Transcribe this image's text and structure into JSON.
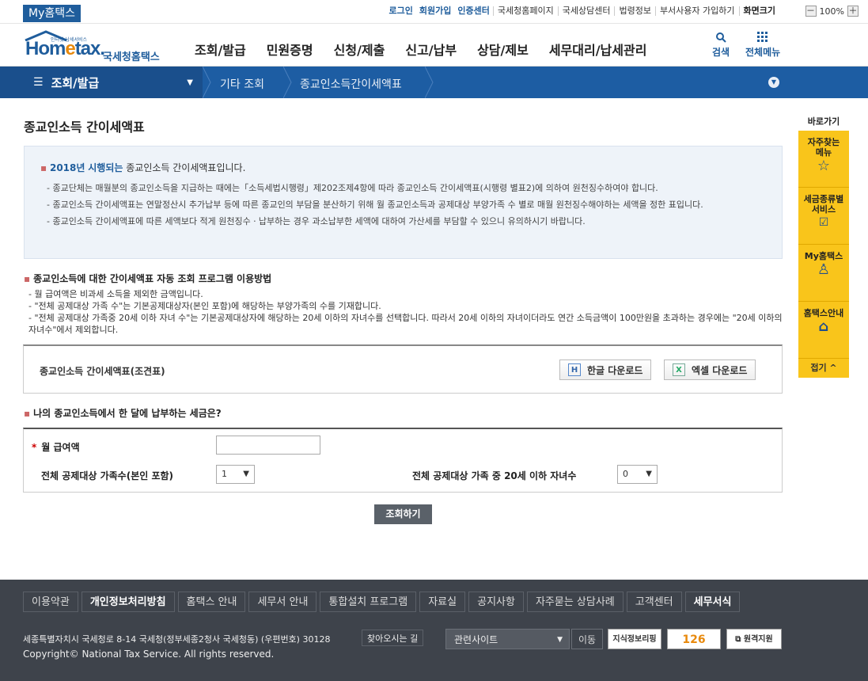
{
  "top": {
    "myhometax": "My홈택스",
    "links_bold": [
      "로그인",
      "회원가입",
      "인증센터"
    ],
    "links": [
      "국세청홈페이지",
      "국세상담센터",
      "법령정보",
      "부서사용자 가입하기"
    ],
    "font_label": "화면크기",
    "zoom_minus": "－",
    "zoom": "100%",
    "zoom_plus": "＋"
  },
  "header": {
    "logo_small": "인터넷 납세서비스",
    "logo_main": "Hom",
    "logo_e": "e",
    "logo_end": "tax.",
    "logo_name": "국세청홈택스",
    "nav": [
      "조회/발급",
      "민원증명",
      "신청/제출",
      "신고/납부",
      "상담/제보",
      "세무대리/납세관리"
    ],
    "search_label": "검색",
    "allmenu_label": "전체메뉴"
  },
  "location": {
    "menu": "조회/발급",
    "crumb1": "기타 조회",
    "crumb2": "종교인소득간이세액표"
  },
  "page": {
    "title": "종교인소득 간이세액표",
    "notice_year": "2018년",
    "notice_hl": "시행되는",
    "notice_rest": "종교인소득 간이세액표입니다.",
    "notice_items": [
      "- 종교단체는 매월분의 종교인소득을 지급하는 때에는「소득세법시행령」제202조제4항에 따라 종교인소득 간이세액표(시행령 별표2)에 의하여 원천징수하여야 합니다.",
      "- 종교인소득 간이세액표는 연말정산시 추가납부 등에 따른 종교인의 부담을 분산하기 위해 월 종교인소득과 공제대상 부양가족 수 별로 매월 원천징수해야하는 세액을 정한 표입니다.",
      "- 종교인소득 간이세액표에 따른 세액보다 적게 원천징수ㆍ납부하는 경우 과소납부한 세액에 대하여 가산세를 부담할 수 있으니 유의하시기 바랍니다."
    ],
    "guide_title": "종교인소득에 대한 간이세액표 자동 조회 프로그램 이용방법",
    "guide_items": [
      "- 월 급여액은 비과세 소득을 제외한 금액입니다.",
      "- \"전체 공제대상 가족 수\"는 기본공제대상자(본인 포함)에 해당하는 부양가족의 수를 기재합니다.",
      "- \"전체 공제대상 가족중 20세 이하 자녀 수\"는 기본공제대상자에 해당하는 20세 이하의 자녀수를 선택합니다. 따라서 20세 이하의 자녀이더라도 연간 소득금액이 100만원을 초과하는 경우에는 \"20세 이하의 자녀수\"에서 제외합니다."
    ],
    "download_title": "종교인소득 간이세액표(조견표)",
    "hangul_download": "한글 다운로드",
    "excel_download": "엑셀 다운로드",
    "form_title": "나의 종교인소득에서 한 달에 납부하는 세금은?",
    "monthly_pay_label": "월 급여액",
    "monthly_pay_value": "",
    "family_label": "전체 공제대상 가족수(본인 포함)",
    "family_value": "1",
    "children_label": "전체 공제대상 가족 중 20세 이하 자녀수",
    "children_value": "0",
    "search_button": "조회하기"
  },
  "quick": {
    "title": "바로가기",
    "items": [
      "자주찾는 메뉴",
      "세금종류별 서비스",
      "My홈택스",
      "홈택스안내"
    ],
    "fold": "접기 ^"
  },
  "footer": {
    "links": [
      "이용약관",
      "개인정보처리방침",
      "홈택스 안내",
      "세무서 안내",
      "통합설치 프로그램",
      "자료실",
      "공지사항",
      "자주묻는 상담사례",
      "고객센터",
      "세무서식"
    ],
    "address": "세종특별자치시 국세청로 8-14 국세청(정부세종2청사 국세청동) (우편번호) 30128",
    "findway": "찾아오시는 길",
    "copyright": "Copyright© National Tax Service. All rights reserved.",
    "related": "관련사이트",
    "go": "이동",
    "banner1": "지식정보리핑",
    "banner2": "126",
    "banner3": "원격지원"
  }
}
